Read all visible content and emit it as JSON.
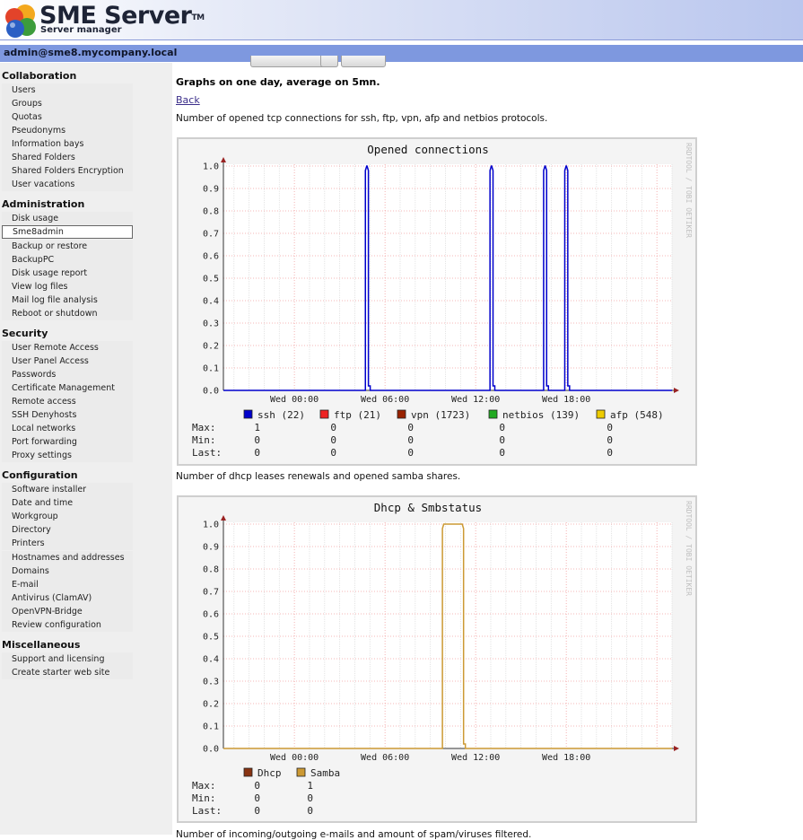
{
  "header": {
    "brand": "SME Server",
    "trademark": "TM",
    "subtitle": "Server manager",
    "user": "admin@sme8.mycompany.local"
  },
  "sidebar": {
    "sections": [
      {
        "title": "Collaboration",
        "items": [
          "Users",
          "Groups",
          "Quotas",
          "Pseudonyms",
          "Information bays",
          "Shared Folders",
          "Shared Folders Encryption",
          "User vacations"
        ]
      },
      {
        "title": "Administration",
        "items": [
          "Disk usage",
          "Sme8admin",
          "Backup or restore",
          "BackupPC",
          "Disk usage report",
          "View log files",
          "Mail log file analysis",
          "Reboot or shutdown"
        ]
      },
      {
        "title": "Security",
        "items": [
          "User Remote Access",
          "User Panel Access",
          "Passwords",
          "Certificate Management",
          "Remote access",
          "SSH Denyhosts",
          "Local networks",
          "Port forwarding",
          "Proxy settings"
        ]
      },
      {
        "title": "Configuration",
        "items": [
          "Software installer",
          "Date and time",
          "Workgroup",
          "Directory",
          "Printers",
          "Hostnames and addresses",
          "Domains",
          "E-mail",
          "Antivirus (ClamAV)",
          "OpenVPN-Bridge",
          "Review configuration"
        ]
      },
      {
        "title": "Miscellaneous",
        "items": [
          "Support and licensing",
          "Create starter web site"
        ]
      }
    ],
    "active": "Sme8admin"
  },
  "content": {
    "top_partial_label": "",
    "heading": "Graphs on one day, average on 5mn.",
    "back_link": "Back",
    "desc1": "Number of opened tcp connections for ssh, ftp, vpn, afp and netbios protocols.",
    "desc2": "Number of dhcp leases renewals and opened samba shares.",
    "desc3": "Number of incoming/outgoing e-mails and amount of spam/viruses filtered."
  },
  "colors": {
    "ssh": "#0000cc",
    "ftp": "#ee2222",
    "vpn": "#992200",
    "netbios": "#22aa22",
    "afp": "#eecc00",
    "dhcp": "#883311",
    "samba": "#cc9933"
  },
  "chart_data": [
    {
      "type": "line",
      "title": "Opened connections",
      "side_text": "RRDTOOL / TOBI OETIKER",
      "x_ticks": [
        "Wed 00:00",
        "Wed 06:00",
        "Wed 12:00",
        "Wed 18:00"
      ],
      "y_ticks": [
        "1.0",
        "0.9",
        "0.8",
        "0.7",
        "0.6",
        "0.5",
        "0.4",
        "0.3",
        "0.2",
        "0.1",
        "0.0"
      ],
      "x_range_hours": [
        -4.7,
        25.0
      ],
      "ylim": [
        0,
        1
      ],
      "stats_labels": [
        "Max:",
        "Min:",
        "Last:"
      ],
      "series": [
        {
          "name": "ssh (22)",
          "color_key": "ssh",
          "max": "1",
          "min": "0",
          "last": "0",
          "pulses": [
            [
              4.7,
              4.9,
              0.98
            ],
            [
              12.95,
              13.15,
              0.98
            ],
            [
              16.5,
              16.7,
              0.98
            ],
            [
              17.9,
              18.1,
              0.98
            ]
          ]
        },
        {
          "name": "ftp (21)",
          "color_key": "ftp",
          "max": "0",
          "min": "0",
          "last": "0",
          "pulses": []
        },
        {
          "name": "vpn (1723)",
          "color_key": "vpn",
          "max": "0",
          "min": "0",
          "last": "0",
          "pulses": []
        },
        {
          "name": "netbios (139)",
          "color_key": "netbios",
          "max": "0",
          "min": "0",
          "last": "0",
          "pulses": []
        },
        {
          "name": "afp (548)",
          "color_key": "afp",
          "max": "0",
          "min": "0",
          "last": "0",
          "pulses": []
        }
      ]
    },
    {
      "type": "line",
      "title": "Dhcp & Smbstatus",
      "side_text": "RRDTOOL / TOBI OETIKER",
      "x_ticks": [
        "Wed 00:00",
        "Wed 06:00",
        "Wed 12:00",
        "Wed 18:00"
      ],
      "y_ticks": [
        "1.0",
        "0.9",
        "0.8",
        "0.7",
        "0.6",
        "0.5",
        "0.4",
        "0.3",
        "0.2",
        "0.1",
        "0.0"
      ],
      "x_range_hours": [
        -4.7,
        25.0
      ],
      "ylim": [
        0,
        1
      ],
      "stats_labels": [
        "Max:",
        "Min:",
        "Last:"
      ],
      "series": [
        {
          "name": "Dhcp",
          "color_key": "dhcp",
          "max": "0",
          "min": "0",
          "last": "0",
          "pulses": []
        },
        {
          "name": "Samba",
          "color_key": "samba",
          "max": "1",
          "min": "0",
          "last": "0",
          "pulses": [
            [
              9.8,
              11.2,
              0.98
            ]
          ]
        }
      ]
    }
  ]
}
